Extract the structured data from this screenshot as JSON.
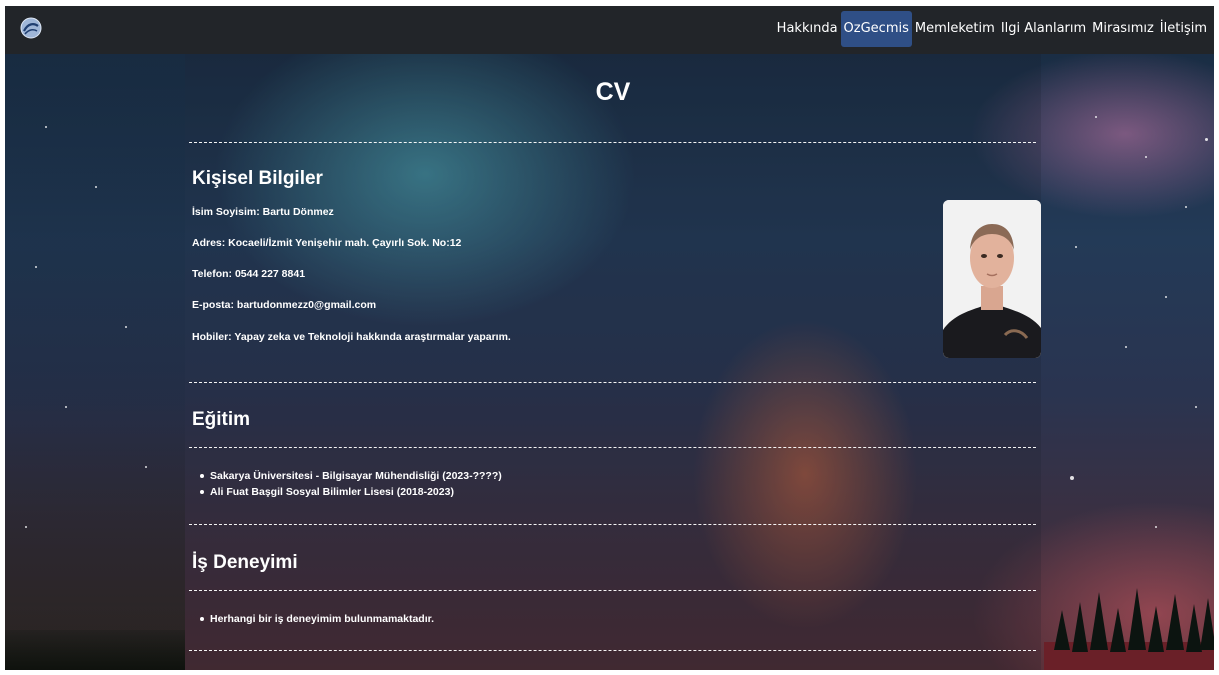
{
  "navbar": {
    "brand_icon": "globe-logo",
    "links": [
      {
        "label": "Hakkında",
        "active": false
      },
      {
        "label": "OzGecmis",
        "active": true
      },
      {
        "label": "Memleketim",
        "active": false
      },
      {
        "label": "Ilgi Alanlarım",
        "active": false
      },
      {
        "label": "Mirasımız",
        "active": false
      },
      {
        "label": "İletişim",
        "active": false
      }
    ],
    "active_color": "#2f4f86",
    "background": "#222529"
  },
  "page": {
    "title": "CV"
  },
  "personal": {
    "heading": "Kişisel Bilgiler",
    "name": "İsim Soyisim: Bartu Dönmez",
    "address": "Adres: Kocaeli/İzmit Yenişehir mah. Çayırlı Sok. No:12",
    "phone": "Telefon: 0544 227 8841",
    "email": "E-posta: bartudonmezz0@gmail.com",
    "hobbies": "Hobiler: Yapay zeka ve Teknoloji hakkında araştırmalar yaparım."
  },
  "education": {
    "heading": "Eğitim",
    "items": [
      "Sakarya Üniversitesi - Bilgisayar Mühendisliği (2023-????)",
      "Ali Fuat Başgil Sosyal Bilimler Lisesi (2018-2023)"
    ]
  },
  "experience": {
    "heading": "İş Deneyimi",
    "items": [
      "Herhangi bir iş deneyimim bulunmamaktadır."
    ]
  }
}
